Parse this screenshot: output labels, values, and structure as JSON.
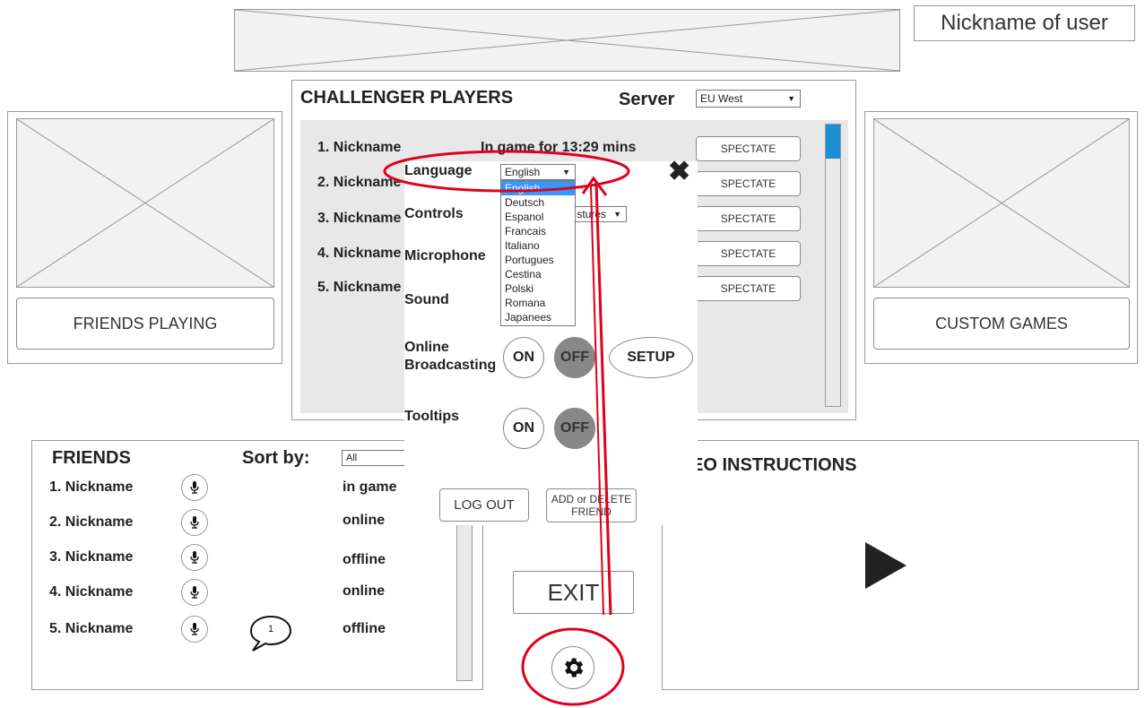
{
  "header": {
    "nickname": "Nickname of user"
  },
  "challenger": {
    "title": "CHALLENGER PLAYERS",
    "server_label": "Server",
    "server_value": "EU West",
    "status_text": "In game for 13:29 mins",
    "spectate_label": "SPECTATE",
    "players": [
      "1. Nickname",
      "2. Nickname",
      "3. Nickname",
      "4. Nickname",
      "5. Nickname"
    ]
  },
  "side": {
    "friends_playing": "FRIENDS PLAYING",
    "custom_games": "CUSTOM GAMES"
  },
  "friends": {
    "title": "FRIENDS",
    "sort_label": "Sort by:",
    "sort_value": "All",
    "rows": [
      {
        "name": "1. Nickname",
        "status": "in game"
      },
      {
        "name": "2. Nickname",
        "status": "online"
      },
      {
        "name": "3. Nickname",
        "status": "offline"
      },
      {
        "name": "4. Nickname",
        "status": "online"
      },
      {
        "name": "5. Nickname",
        "status": "offline"
      }
    ],
    "message_count": "1"
  },
  "video": {
    "title": "EO INSTRUCTIONS"
  },
  "settings": {
    "language_label": "Language",
    "language_value": "English",
    "languages": [
      "English",
      "Deutsch",
      "Espanol",
      "Francais",
      "Italiano",
      "Portugues",
      "Cestina",
      "Polski",
      "Romana",
      "Japanees"
    ],
    "controls_label": "Controls",
    "controls_value": "stures",
    "microphone_label": "Microphone",
    "sound_label": "Sound",
    "broadcast_label_1": "Online",
    "broadcast_label_2": "Broadcasting",
    "tooltips_label": "Tooltips",
    "on_label": "ON",
    "off_label": "OFF",
    "setup_label": "SETUP",
    "logout_label": "LOG OUT",
    "add_delete_label_1": "ADD or DELETE",
    "add_delete_label_2": "FRIEND",
    "exit_label": "EXIT"
  },
  "colors": {
    "annotation": "#e0001a",
    "scroll_thumb": "#1e8fd6",
    "selected": "#3399ff",
    "off_fill": "#888888",
    "panel_bg": "#e8e8e8"
  }
}
